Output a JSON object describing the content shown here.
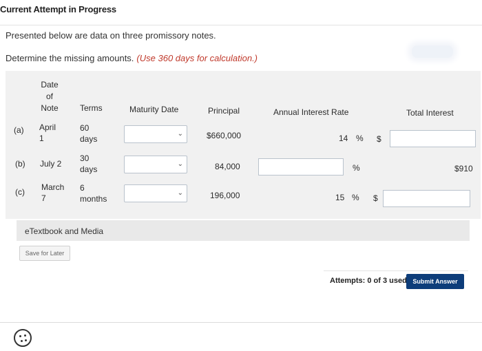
{
  "header": {
    "title": "Current Attempt in Progress"
  },
  "intro": "Presented below are data on three promissory notes.",
  "instructions": {
    "text": "Determine the missing amounts.",
    "note": "(Use 360 days for calculation.)"
  },
  "table": {
    "headers": {
      "date_line1": "Date",
      "date_line2": "of",
      "date_line3": "Note",
      "terms": "Terms",
      "maturity": "Maturity Date",
      "principal": "Principal",
      "rate": "Annual Interest Rate",
      "interest": "Total Interest"
    },
    "rows": [
      {
        "label": "(a)",
        "date_line1": "April",
        "date_line2": "1",
        "terms_line1": "60",
        "terms_line2": "days",
        "principal": "$660,000",
        "rate": "14",
        "rate_unit": "%",
        "interest_prefix": "$"
      },
      {
        "label": "(b)",
        "date_line1": "July 2",
        "terms_line1": "30",
        "terms_line2": "days",
        "principal": "84,000",
        "rate_unit": "%",
        "interest": "$910"
      },
      {
        "label": "(c)",
        "date_line1": "March",
        "date_line2": "7",
        "terms_line1": "6",
        "terms_line2": "months",
        "principal": "196,000",
        "rate": "15",
        "rate_unit": "%",
        "interest_prefix": "$"
      }
    ]
  },
  "etextbook": {
    "label": "eTextbook and Media"
  },
  "buttons": {
    "save": "Save for Later",
    "submit": "Submit Answer"
  },
  "attempts": "Attempts: 0 of 3 used",
  "icons": {
    "dropdown": "chevron-down-icon",
    "help": "help-icon"
  }
}
